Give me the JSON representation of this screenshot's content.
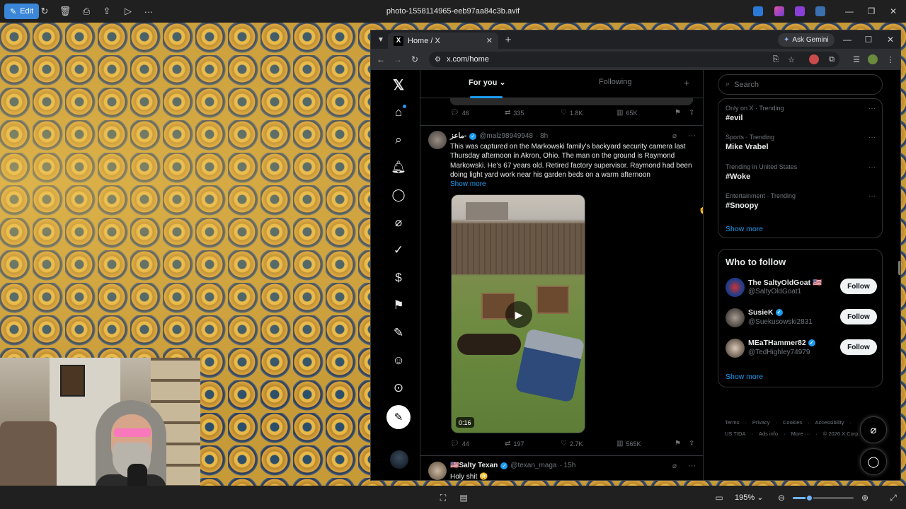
{
  "viewer": {
    "edit_label": "Edit",
    "file_title": "photo-1558114965-eeb97aa84c3b.avif",
    "zoom": "195%",
    "zoom_level": 0.27
  },
  "browser": {
    "tab_title": "Home / X",
    "gemini_label": "Ask Gemini",
    "url": "x.com/home"
  },
  "timeline": {
    "tab_for_you": "For you",
    "tab_following": "Following",
    "prev_actions": {
      "replies": "46",
      "reposts": "335",
      "likes": "1.8K",
      "views": "65K"
    },
    "tweet1": {
      "name": "ماعز-",
      "handle": "@malz98949948",
      "time": "· 8h",
      "text": "This was captured on the Markowski family's backyard security camera last Thursday afternoon in Akron, Ohio. The man on the ground is Raymond Markowski. He's 67 years old. Retired factory supervisor. Raymond had been doing light yard work near his garden beds on a warm afternoon",
      "show_more": "Show more",
      "duration": "0:16",
      "actions": {
        "replies": "44",
        "reposts": "197",
        "likes": "2.7K",
        "views": "565K"
      }
    },
    "tweet2": {
      "name": "🇺🇸Salty Texan",
      "handle": "@texan_maga",
      "time": "· 15h",
      "text": "Holy shit 😳"
    }
  },
  "sidebar": {
    "search_placeholder": "Search",
    "trends": [
      {
        "meta": "Only on X · Trending",
        "name": "#evil"
      },
      {
        "meta": "Sports · Trending",
        "name": "Mike Vrabel"
      },
      {
        "meta": "Trending in United States",
        "name": "#Woke"
      },
      {
        "meta": "Entertainment · Trending",
        "name": "#Snoopy"
      }
    ],
    "trends_show_more": "Show more",
    "who_to_follow": "Who to follow",
    "follow": [
      {
        "name": "The SaltyOldGoat 🇺🇸",
        "handle": "@SaltyOldGoat1",
        "button": "Follow"
      },
      {
        "name": "SusieK",
        "handle": "@Suekusowski2831",
        "button": "Follow"
      },
      {
        "name": "MEaTHammer82",
        "handle": "@TedHighley74979",
        "button": "Follow"
      }
    ],
    "follow_show_more": "Show more",
    "footer_line1": [
      "Terms",
      "·",
      "Privacy",
      "·",
      "Cookies",
      "·",
      "Accessibility",
      "·"
    ],
    "footer_line2": [
      "US TIDA",
      "·",
      "Ads info",
      "·",
      "More ···",
      "·",
      "© 2026 X Corp."
    ]
  }
}
